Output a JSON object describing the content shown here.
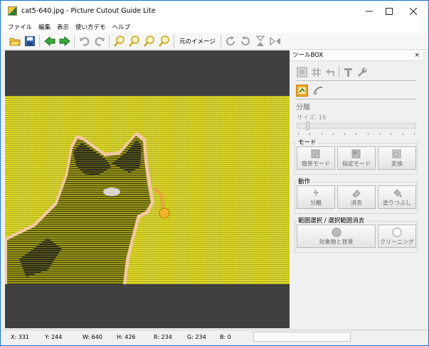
{
  "window": {
    "title": "cat5-640.jpg - Picture Cutout Guide Lite"
  },
  "menu": [
    "ファイル",
    "編集",
    "表示",
    "使い方デモ",
    "ヘルプ"
  ],
  "toolbar": {
    "original_image_label": "元のイメージ"
  },
  "toolbox": {
    "header": "ツールBOX",
    "close": "×",
    "section_separate": "分離",
    "size_label": "サイズ: 16",
    "size_value": 16,
    "mode": {
      "title": "モード",
      "buttons": [
        "簡単モード",
        "指定モード",
        "変換"
      ]
    },
    "action": {
      "title": "動作",
      "buttons": [
        "分離",
        "消去",
        "塗りつぶし"
      ]
    },
    "range": {
      "title": "範囲選択 / 選択範囲消去",
      "buttons": [
        "対象物と背景",
        "クリーニング"
      ]
    }
  },
  "status": {
    "x": "X: 331",
    "y": "Y: 244",
    "w": "W: 640",
    "h": "H: 426",
    "r": "R: 234",
    "g": "G: 234",
    "b": "B: 0"
  },
  "colors": {
    "accent": "#0078d7",
    "image_yellow": "#d9d420",
    "canvas_bg": "#404040",
    "active_tool": "#f9a825"
  }
}
